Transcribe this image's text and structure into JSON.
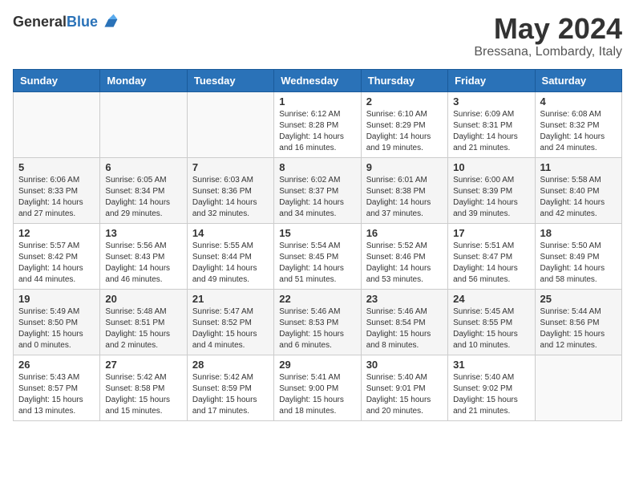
{
  "logo": {
    "line1": "General",
    "line2": "Blue"
  },
  "header": {
    "month_year": "May 2024",
    "location": "Bressana, Lombardy, Italy"
  },
  "weekdays": [
    "Sunday",
    "Monday",
    "Tuesday",
    "Wednesday",
    "Thursday",
    "Friday",
    "Saturday"
  ],
  "weeks": [
    [
      {
        "day": "",
        "info": ""
      },
      {
        "day": "",
        "info": ""
      },
      {
        "day": "",
        "info": ""
      },
      {
        "day": "1",
        "info": "Sunrise: 6:12 AM\nSunset: 8:28 PM\nDaylight: 14 hours\nand 16 minutes."
      },
      {
        "day": "2",
        "info": "Sunrise: 6:10 AM\nSunset: 8:29 PM\nDaylight: 14 hours\nand 19 minutes."
      },
      {
        "day": "3",
        "info": "Sunrise: 6:09 AM\nSunset: 8:31 PM\nDaylight: 14 hours\nand 21 minutes."
      },
      {
        "day": "4",
        "info": "Sunrise: 6:08 AM\nSunset: 8:32 PM\nDaylight: 14 hours\nand 24 minutes."
      }
    ],
    [
      {
        "day": "5",
        "info": "Sunrise: 6:06 AM\nSunset: 8:33 PM\nDaylight: 14 hours\nand 27 minutes."
      },
      {
        "day": "6",
        "info": "Sunrise: 6:05 AM\nSunset: 8:34 PM\nDaylight: 14 hours\nand 29 minutes."
      },
      {
        "day": "7",
        "info": "Sunrise: 6:03 AM\nSunset: 8:36 PM\nDaylight: 14 hours\nand 32 minutes."
      },
      {
        "day": "8",
        "info": "Sunrise: 6:02 AM\nSunset: 8:37 PM\nDaylight: 14 hours\nand 34 minutes."
      },
      {
        "day": "9",
        "info": "Sunrise: 6:01 AM\nSunset: 8:38 PM\nDaylight: 14 hours\nand 37 minutes."
      },
      {
        "day": "10",
        "info": "Sunrise: 6:00 AM\nSunset: 8:39 PM\nDaylight: 14 hours\nand 39 minutes."
      },
      {
        "day": "11",
        "info": "Sunrise: 5:58 AM\nSunset: 8:40 PM\nDaylight: 14 hours\nand 42 minutes."
      }
    ],
    [
      {
        "day": "12",
        "info": "Sunrise: 5:57 AM\nSunset: 8:42 PM\nDaylight: 14 hours\nand 44 minutes."
      },
      {
        "day": "13",
        "info": "Sunrise: 5:56 AM\nSunset: 8:43 PM\nDaylight: 14 hours\nand 46 minutes."
      },
      {
        "day": "14",
        "info": "Sunrise: 5:55 AM\nSunset: 8:44 PM\nDaylight: 14 hours\nand 49 minutes."
      },
      {
        "day": "15",
        "info": "Sunrise: 5:54 AM\nSunset: 8:45 PM\nDaylight: 14 hours\nand 51 minutes."
      },
      {
        "day": "16",
        "info": "Sunrise: 5:52 AM\nSunset: 8:46 PM\nDaylight: 14 hours\nand 53 minutes."
      },
      {
        "day": "17",
        "info": "Sunrise: 5:51 AM\nSunset: 8:47 PM\nDaylight: 14 hours\nand 56 minutes."
      },
      {
        "day": "18",
        "info": "Sunrise: 5:50 AM\nSunset: 8:49 PM\nDaylight: 14 hours\nand 58 minutes."
      }
    ],
    [
      {
        "day": "19",
        "info": "Sunrise: 5:49 AM\nSunset: 8:50 PM\nDaylight: 15 hours\nand 0 minutes."
      },
      {
        "day": "20",
        "info": "Sunrise: 5:48 AM\nSunset: 8:51 PM\nDaylight: 15 hours\nand 2 minutes."
      },
      {
        "day": "21",
        "info": "Sunrise: 5:47 AM\nSunset: 8:52 PM\nDaylight: 15 hours\nand 4 minutes."
      },
      {
        "day": "22",
        "info": "Sunrise: 5:46 AM\nSunset: 8:53 PM\nDaylight: 15 hours\nand 6 minutes."
      },
      {
        "day": "23",
        "info": "Sunrise: 5:46 AM\nSunset: 8:54 PM\nDaylight: 15 hours\nand 8 minutes."
      },
      {
        "day": "24",
        "info": "Sunrise: 5:45 AM\nSunset: 8:55 PM\nDaylight: 15 hours\nand 10 minutes."
      },
      {
        "day": "25",
        "info": "Sunrise: 5:44 AM\nSunset: 8:56 PM\nDaylight: 15 hours\nand 12 minutes."
      }
    ],
    [
      {
        "day": "26",
        "info": "Sunrise: 5:43 AM\nSunset: 8:57 PM\nDaylight: 15 hours\nand 13 minutes."
      },
      {
        "day": "27",
        "info": "Sunrise: 5:42 AM\nSunset: 8:58 PM\nDaylight: 15 hours\nand 15 minutes."
      },
      {
        "day": "28",
        "info": "Sunrise: 5:42 AM\nSunset: 8:59 PM\nDaylight: 15 hours\nand 17 minutes."
      },
      {
        "day": "29",
        "info": "Sunrise: 5:41 AM\nSunset: 9:00 PM\nDaylight: 15 hours\nand 18 minutes."
      },
      {
        "day": "30",
        "info": "Sunrise: 5:40 AM\nSunset: 9:01 PM\nDaylight: 15 hours\nand 20 minutes."
      },
      {
        "day": "31",
        "info": "Sunrise: 5:40 AM\nSunset: 9:02 PM\nDaylight: 15 hours\nand 21 minutes."
      },
      {
        "day": "",
        "info": ""
      }
    ]
  ]
}
